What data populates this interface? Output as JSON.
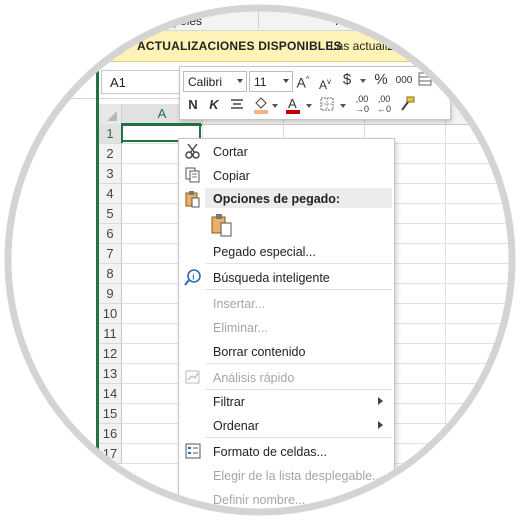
{
  "ribbon": {
    "group_left": "papeles",
    "group_right": "Fu"
  },
  "banner": {
    "title": "ACTUALIZACIONES DISPONIBLES",
    "text": "Las actualiz"
  },
  "name_box": "A1",
  "columns": [
    "A"
  ],
  "rows": [
    "1",
    "2",
    "3",
    "4",
    "5",
    "6",
    "7",
    "8",
    "9",
    "10",
    "11",
    "12",
    "13",
    "14",
    "15",
    "16",
    "17"
  ],
  "mini_toolbar": {
    "font": "Calibri",
    "size": "11",
    "currency": "$",
    "percent": "%",
    "thousands": "000",
    "bold": "N",
    "italic": "K",
    "decimals_add": ",00",
    "decimals_remove": ",00",
    "fill_color": "#f4b183",
    "font_color": "#c00000"
  },
  "context_menu": {
    "cut": "Cortar",
    "copy": "Copiar",
    "paste_options": "Opciones de pegado:",
    "paste_special": "Pegado especial...",
    "smart_lookup": "Búsqueda inteligente",
    "insert": "Insertar...",
    "delete": "Eliminar...",
    "clear_contents": "Borrar contenido",
    "quick_analysis": "Análisis rápido",
    "filter": "Filtrar",
    "sort": "Ordenar",
    "format_cells": "Formato de celdas...",
    "pick_from_list": "Elegir de la lista desplegable...",
    "define_name": "Definir nombre..."
  },
  "colors": {
    "accent": "#217346",
    "banner_bg": "#fff3b8"
  }
}
